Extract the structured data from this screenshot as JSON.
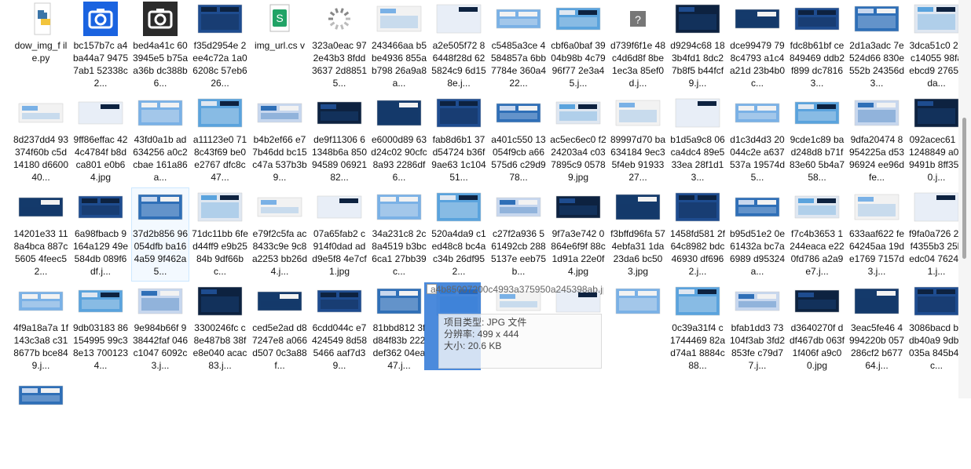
{
  "files": [
    {
      "label": "dow_img_f ile.py",
      "icon": "python-icon"
    },
    {
      "label": "bc157b7c a4ba44a7 94757ab1 52338c2...",
      "icon": "camera-icon"
    },
    {
      "label": "bed4a41c 603945e5 b75aa36b dc388b6...",
      "icon": "camera-icon"
    },
    {
      "label": "f35d2954e 2ee4c72a 1a06208c 57eb626...",
      "icon": "image-thumbnail"
    },
    {
      "label": "img_url.cs v",
      "icon": "csv-icon"
    },
    {
      "label": "323a0eac 972e43b3 8fdd3637 2d88515...",
      "icon": "loading-icon"
    },
    {
      "label": "243466aa b5be4936 855ab798 26a9a8a...",
      "icon": "image-thumbnail"
    },
    {
      "label": "a2e505f72 86448f28d 625824c9 6d158e.j...",
      "icon": "image-thumbnail"
    },
    {
      "label": "c5485a3ce 4584857a 6bb7784e 360a422...",
      "icon": "image-thumbnail"
    },
    {
      "label": "cbf6a0baf 3904b98b 4c7996f77 2e3a45.j...",
      "icon": "image-thumbnail"
    },
    {
      "label": "d739f6f1e 48c4d6d8f 8be1ec3a 85ef0d.j...",
      "icon": "unknown-icon"
    },
    {
      "label": "d9294c68 183b4fd1 8dc27b8f5 b44fcf9.j...",
      "icon": "image-thumbnail"
    },
    {
      "label": "dce99479 798c4793 a1c4a21d 23b4b0c...",
      "icon": "image-thumbnail"
    },
    {
      "label": "fdc8b61bf ce849469 ddb2f899 dc78163...",
      "icon": "image-thumbnail"
    },
    {
      "label": "2d1a3adc 7e524d66 830e552b 24356d3...",
      "icon": "image-thumbnail"
    },
    {
      "label": "3dca51c0 20c14055 98faebcd9 27658da...",
      "icon": "image-thumbnail"
    },
    {
      "label": "8d237dd4 93374f60b c5d14180 d660040...",
      "icon": "image-thumbnail"
    },
    {
      "label": "9ff86effac 424c4784f b8dca801 e0b64.jpg",
      "icon": "image-thumbnail"
    },
    {
      "label": "43fd0a1b ad634256 a0c2cbae 161a86a...",
      "icon": "image-thumbnail"
    },
    {
      "label": "a11123e0 718c43f69 be0e2767 dfc8c47...",
      "icon": "image-thumbnail"
    },
    {
      "label": "b4b2ef66 e77b46dd bc15c47a 537b3b9...",
      "icon": "image-thumbnail"
    },
    {
      "label": "de9f11306 61348b6a 85094589 0692182...",
      "icon": "image-thumbnail"
    },
    {
      "label": "e6000d89 63d24c02 90cfc8a93 2286df6...",
      "icon": "image-thumbnail"
    },
    {
      "label": "fab8d6b1 37d54724 b36f9ae63 1c10451...",
      "icon": "image-thumbnail"
    },
    {
      "label": "a401c550 13054f9cb a66575d6 c29d978...",
      "icon": "image-thumbnail"
    },
    {
      "label": "ac5ec6ec0 f224203a4 c037895c9 05789.jpg",
      "icon": "image-thumbnail"
    },
    {
      "label": "89997d70 ba634184 9ec35f4eb 9193327...",
      "icon": "image-thumbnail"
    },
    {
      "label": "b1d5a9c8 06ca4dc4 89e533ea 28f1d13...",
      "icon": "image-thumbnail"
    },
    {
      "label": "d1c3d4d3 20044c2e a637537a 19574d5...",
      "icon": "image-thumbnail"
    },
    {
      "label": "9cde1c89 bad248d8 b71f83e60 5b4a758...",
      "icon": "image-thumbnail"
    },
    {
      "label": "9dfa20474 8954225a d5396924 ee96dfe...",
      "icon": "image-thumbnail"
    },
    {
      "label": "092acec61 81248849 a0b9491b 8ff35a0.j...",
      "icon": "image-thumbnail"
    },
    {
      "label": "14201e33 118a4bca 887c5605 4feec52...",
      "icon": "image-thumbnail"
    },
    {
      "label": "6a98fbacb 9164a129 49e584db 089f6df.j...",
      "icon": "image-thumbnail"
    },
    {
      "label": "37d2b856 96054dfb ba164a59 9f462a5...",
      "icon": "image-thumbnail",
      "selected": true
    },
    {
      "label": "71dc11bb 6fed44ff9 e9b2584b 9df66bc...",
      "icon": "image-thumbnail"
    },
    {
      "label": "e79f2c5fa ac8433c9e 9c8a2253 bb26d4.j...",
      "icon": "image-thumbnail"
    },
    {
      "label": "07a65fab2 c914f0dad add9e5f8 4e7cf1.jpg",
      "icon": "image-thumbnail"
    },
    {
      "label": "34a231c8 2c8a4519 b3bc6ca1 27bb39c...",
      "icon": "image-thumbnail"
    },
    {
      "label": "520a4da9 c1ed48c8 bc4ac34b 26df952...",
      "icon": "image-thumbnail"
    },
    {
      "label": "c27f2a936 561492cb 2885137e eeb75b...",
      "icon": "image-thumbnail"
    },
    {
      "label": "9f7a3e742 0864e6f9f 88c1d91a 22e0f4.jpg",
      "icon": "image-thumbnail"
    },
    {
      "label": "f3bffd96fa 574ebfa31 1da23da6 bc503.jpg",
      "icon": "image-thumbnail"
    },
    {
      "label": "1458fd581 2f64c8982 bdc46930 df6962.j...",
      "icon": "image-thumbnail"
    },
    {
      "label": "b95d51e2 0e61432a bc7a6989 d95324a...",
      "icon": "image-thumbnail"
    },
    {
      "label": "f7c4b3653 1244eaca e220fd786 a2a9e7.j...",
      "icon": "image-thumbnail"
    },
    {
      "label": "633aaf622 fe64245aa 19de1769 7157d3.j...",
      "icon": "image-thumbnail"
    },
    {
      "label": "f9fa0a726 24f4355b3 25bedc04 7624b1.j...",
      "icon": "image-thumbnail"
    },
    {
      "label": "4f9a18a7a 1f143c3a8 c318677b bce849.j...",
      "icon": "image-thumbnail"
    },
    {
      "label": "9db03183 86154995 99c38e13 7001234...",
      "icon": "image-thumbnail"
    },
    {
      "label": "9e984b66f 938442faf 046c1047 6092c3.j...",
      "icon": "image-thumbnail"
    },
    {
      "label": "3300246fc c8e487b8 38fe8e040 acac83.j...",
      "icon": "image-thumbnail"
    },
    {
      "label": "ced5e2ad d87247e8 a066d507 0c3a88f...",
      "icon": "image-thumbnail"
    },
    {
      "label": "6cdd044c e7424549 8d585466 aaf7d39...",
      "icon": "image-thumbnail"
    },
    {
      "label": "81bbd812 3fd84f83b 222def362 04ea47.j...",
      "icon": "image-thumbnail"
    },
    {
      "label": "",
      "icon": "image-thumbnail"
    },
    {
      "label": "",
      "icon": "image-thumbnail"
    },
    {
      "label": "",
      "icon": "image-thumbnail"
    },
    {
      "label": "",
      "icon": "image-thumbnail"
    },
    {
      "label": "0c39a31f4 c1744469 82ad74a1 8884c88...",
      "icon": "image-thumbnail"
    },
    {
      "label": "bfab1dd3 73104f3ab 3fd2853fe c79d77.j...",
      "icon": "image-thumbnail"
    },
    {
      "label": "d3640270f ddf467db 063f1f406f a9c00.jpg",
      "icon": "image-thumbnail"
    },
    {
      "label": "3eac5fe46 4994220b 057286cf2 b67764.j...",
      "icon": "image-thumbnail"
    },
    {
      "label": "3086bacd b8db40a9 9dba035a 845b46c...",
      "icon": "image-thumbnail"
    },
    {
      "label": "",
      "icon": "image-thumbnail"
    }
  ],
  "tooltip": {
    "title": "a4b85007200c4993a375950a245398ab.jpg",
    "line1": "项目类型: JPG 文件",
    "line2": "分辨率: 499 x 444",
    "line3": "大小: 20.6 KB"
  },
  "colors": {
    "camera_bg": "#1a63e0",
    "camera_dark": "#2b2b2b",
    "select_border": "#cde8ff"
  }
}
